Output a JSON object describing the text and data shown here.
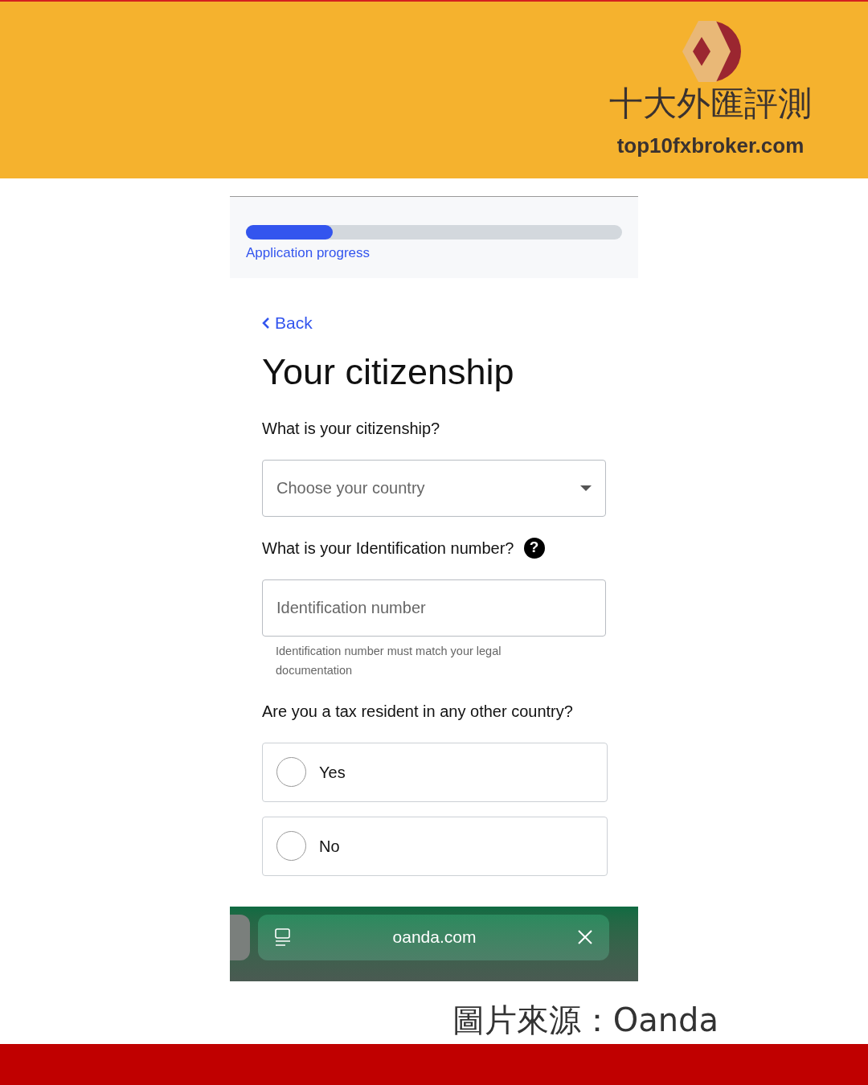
{
  "banner": {
    "brand_name": "十大外匯評測",
    "brand_site": "top10fxbroker.com"
  },
  "progress": {
    "level": 0.23,
    "label": "Application progress"
  },
  "back_link": "Back",
  "title": "Your citizenship",
  "citizenship": {
    "question": "What is your citizenship?",
    "placeholder": "Choose your country"
  },
  "identification": {
    "question": "What is your Identification number?",
    "help_icon": "?",
    "placeholder": "Identification number",
    "hint": "Identification number must match your legal documentation"
  },
  "tax_resident": {
    "question": "Are you a tax resident in any other country?",
    "options": [
      {
        "label": "Yes",
        "selected": false
      },
      {
        "label": "No",
        "selected": false
      }
    ]
  },
  "browser_bar": {
    "address": "oanda.com"
  },
  "caption": "圖片來源：Oanda"
}
